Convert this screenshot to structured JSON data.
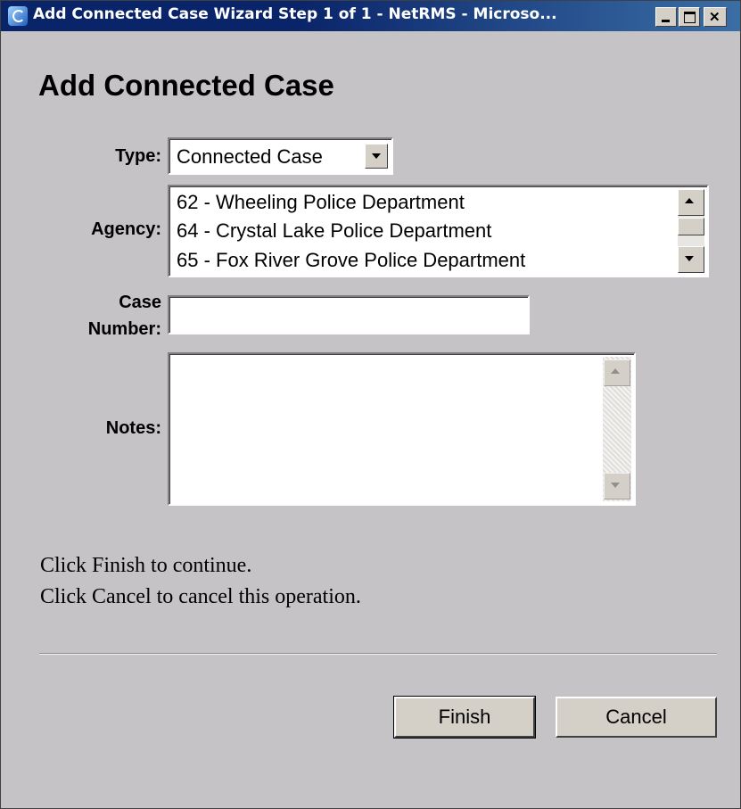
{
  "window": {
    "title": "Add Connected Case Wizard Step 1 of 1 - NetRMS - Microso...",
    "title_bar_color": "#0a246a",
    "icons": [
      "ie-page-icon",
      "minimize-icon",
      "maximize-icon",
      "close-icon"
    ]
  },
  "form": {
    "heading": "Add Connected Case",
    "type": {
      "label": "Type:",
      "value": "Connected Case"
    },
    "agency": {
      "label": "Agency:",
      "options": [
        "62 - Wheeling Police Department",
        "64 - Crystal Lake Police Department",
        "65 - Fox River Grove Police Department"
      ]
    },
    "case_number": {
      "label_line1": "Case",
      "label_line2": "Number:",
      "value": ""
    },
    "notes": {
      "label": "Notes:",
      "value": ""
    }
  },
  "messages": {
    "finish": "Click Finish to continue.",
    "cancel": "Click Cancel to cancel this operation."
  },
  "buttons": {
    "finish": "Finish",
    "cancel": "Cancel"
  }
}
